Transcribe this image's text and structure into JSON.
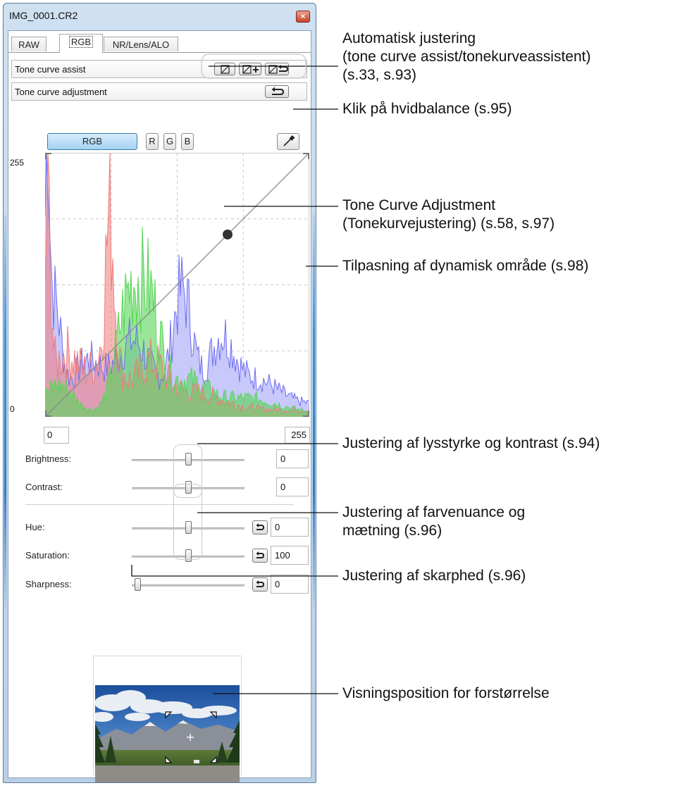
{
  "window": {
    "title": "IMG_0001.CR2",
    "close_glyph": "×",
    "tabs": [
      {
        "label": "RAW",
        "active": false
      },
      {
        "label": "RGB",
        "active": true
      },
      {
        "label": "NR/Lens/ALO",
        "active": false
      }
    ]
  },
  "tone_curve_assist": {
    "label": "Tone curve assist",
    "buttons": [
      "tone-curve-assist-standard-icon",
      "tone-curve-assist-high-icon",
      "tone-curve-assist-reset-icon"
    ]
  },
  "tone_curve_adjustment": {
    "label": "Tone curve adjustment",
    "reset_icon": "reset-arrow-icon"
  },
  "channels": {
    "items": [
      "RGB",
      "R",
      "G",
      "B"
    ],
    "selected": "RGB",
    "eyedropper_icon": "eyedropper-icon"
  },
  "graph": {
    "y_max_label": "255",
    "y_min_label": "0",
    "x_min_value": "0",
    "x_max_value": "255"
  },
  "sliders": [
    {
      "key": "brightness",
      "label": "Brightness:",
      "value": "0",
      "position": 0.5,
      "has_reset": false
    },
    {
      "key": "contrast",
      "label": "Contrast:",
      "value": "0",
      "position": 0.5,
      "has_reset": false
    },
    {
      "key": "hue",
      "label": "Hue:",
      "value": "0",
      "position": 0.5,
      "has_reset": true
    },
    {
      "key": "saturation",
      "label": "Saturation:",
      "value": "100",
      "position": 0.5,
      "has_reset": true
    },
    {
      "key": "sharpness",
      "label": "Sharpness:",
      "value": "0",
      "position": 0.0,
      "has_reset": true
    }
  ],
  "callouts": {
    "auto": "Automatisk justering",
    "auto_sub": "(tone curve assist/tonekurveassistent)",
    "auto_ref": "(s.33, s.93)",
    "wb": "Klik på hvidbalance (s.95)",
    "tca": "Tone Curve Adjustment",
    "tca_sub": "(Tonekurvejustering) (s.58, s.97)",
    "dyn": "Tilpasning af dynamisk område (s.98)",
    "bright": "Justering af lysstyrke og kontrast (s.94)",
    "hue1": "Justering af farvenuance og",
    "hue2": "mætning (s.96)",
    "sharp": "Justering af skarphed (s.96)",
    "view": "Visningsposition for forstørrelse"
  },
  "colors": {
    "histogram_red": "#f07a7a",
    "histogram_green": "#55d655",
    "histogram_blue": "#6e6ef2",
    "histogram_fill": "#c8c8fa",
    "window_frame": "#b8cfe6",
    "active_channel": "#a4d2f3"
  }
}
